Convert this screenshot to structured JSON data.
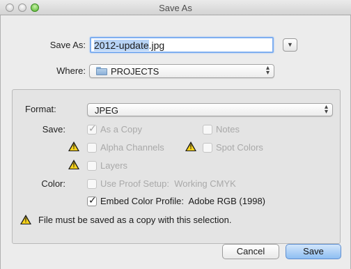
{
  "window": {
    "title": "Save As"
  },
  "save_as": {
    "label": "Save As:",
    "value_selected": "2012-update",
    "value_ext": ".jpg"
  },
  "where": {
    "label": "Where:",
    "value": "PROJECTS",
    "icon": "folder-icon"
  },
  "format": {
    "label": "Format:",
    "value": "JPEG"
  },
  "save_section": {
    "label": "Save:",
    "as_a_copy": {
      "label": "As a Copy",
      "checked": true,
      "enabled": false
    },
    "notes": {
      "label": "Notes",
      "checked": false,
      "enabled": false
    },
    "alpha_channels": {
      "label": "Alpha Channels",
      "checked": false,
      "enabled": false
    },
    "spot_colors": {
      "label": "Spot Colors",
      "checked": false,
      "enabled": false
    },
    "layers": {
      "label": "Layers",
      "checked": false,
      "enabled": false
    }
  },
  "color_section": {
    "label": "Color:",
    "use_proof_setup": {
      "label": "Use Proof Setup:  Working CMYK",
      "checked": false,
      "enabled": false
    },
    "embed_color_profile": {
      "label": "Embed Color Profile:  Adobe RGB (1998)",
      "checked": true,
      "enabled": true
    }
  },
  "warning_message": "File must be saved as a copy with this selection.",
  "buttons": {
    "cancel": "Cancel",
    "save": "Save"
  },
  "colors": {
    "accent": "#7eaef0",
    "selection": "#b7d3f5",
    "warning_yellow": "#f7d21c"
  }
}
